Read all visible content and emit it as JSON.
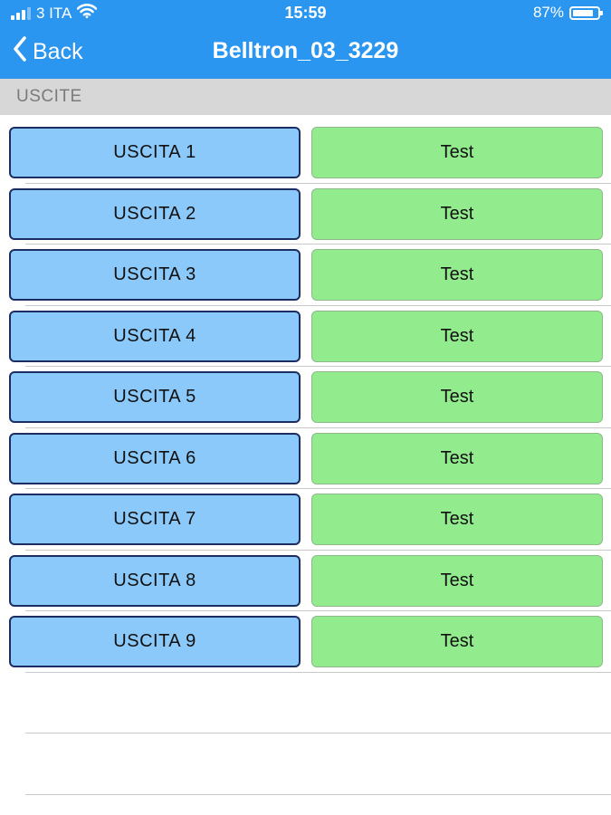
{
  "status_bar": {
    "carrier": "3 ITA",
    "time": "15:59",
    "battery": "87%",
    "battery_level": 0.87,
    "signal_bars": 3,
    "icons": [
      "signal-icon",
      "wifi-icon",
      "battery-icon"
    ]
  },
  "nav": {
    "back_label": "Back",
    "title": "Belltron_03_3229",
    "back_icon": "chevron-left-icon"
  },
  "section": {
    "header": "USCITE"
  },
  "outputs": [
    {
      "label": "USCITA 1",
      "action": "Test"
    },
    {
      "label": "USCITA 2",
      "action": "Test"
    },
    {
      "label": "USCITA 3",
      "action": "Test"
    },
    {
      "label": "USCITA 4",
      "action": "Test"
    },
    {
      "label": "USCITA 5",
      "action": "Test"
    },
    {
      "label": "USCITA 6",
      "action": "Test"
    },
    {
      "label": "USCITA 7",
      "action": "Test"
    },
    {
      "label": "USCITA 8",
      "action": "Test"
    },
    {
      "label": "USCITA 9",
      "action": "Test"
    }
  ],
  "colors": {
    "nav_background": "#2b96f0",
    "section_background": "#d7d7d7",
    "output_button": "#8ac9fa",
    "test_button": "#92ec8e"
  }
}
